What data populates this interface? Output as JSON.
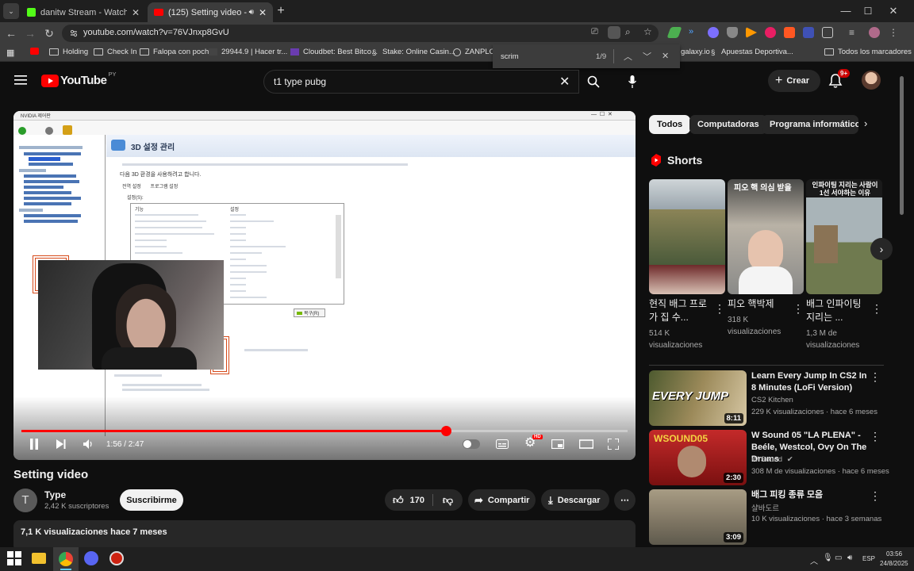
{
  "tabs": [
    {
      "title": "danitw Stream - Watch Live on",
      "active": false
    },
    {
      "title": "(125) Setting video - YouTube",
      "active": true
    }
  ],
  "address": {
    "url": "youtube.com/watch?v=76VJnxp8GvU"
  },
  "bookmarks": [
    "Holding",
    "Check In",
    "Falopa con pochi",
    "29944.9 | Hacer tr...",
    "Cloudbet: Best Bitco...",
    "Stake: Online Casin...",
    "ZANPLO",
    "galaxy.io",
    "Apuestas Deportiva...",
    "Todos los marcadores"
  ],
  "findbar": {
    "query": "scrim",
    "count": "1/9"
  },
  "youtube": {
    "logo_text": "YouTube",
    "country": "PY",
    "search_value": "t1 type pubg",
    "create_label": "Crear",
    "notif_count": "9+"
  },
  "player": {
    "time": "1:56 / 2:47",
    "progress": 0.7,
    "hd_badge": "HD"
  },
  "video": {
    "title": "Setting video",
    "channel": "Type",
    "subscribers": "2,42 K suscriptores",
    "subscribe_label": "Suscribirme",
    "likes": "170",
    "share_label": "Compartir",
    "download_label": "Descargar",
    "views_date": "7,1 K visualizaciones  hace 7 meses"
  },
  "screen_content": {
    "window_title": "NVIDIA 제어판",
    "panel_title": "3D 설정 관리",
    "panel_sub": "다음 3D 환경을 사용하려고 합니다.",
    "tabs": [
      "전역 설정",
      "프로그램 설정"
    ],
    "settings_header": "설정(S):",
    "col_feature": "기능",
    "col_setting": "설정",
    "restore_button": "복구(R)"
  },
  "chips": [
    "Todos",
    "Computadoras",
    "Programa informático"
  ],
  "shorts_title": "Shorts",
  "shorts": [
    {
      "title": "현직 배그 프로가 집 수...",
      "views": "514 K visualizaciones"
    },
    {
      "title": "피오 핵박제",
      "views": "318 K visualizaciones",
      "overlay": "피오 핵 의심 받을"
    },
    {
      "title": "배그 인파이팅 지리는 ...",
      "views": "1,3 M de visualizaciones",
      "overlay": "인파이팅 지리는 사람이\n1선 서야하는 이유"
    }
  ],
  "related": [
    {
      "title": "Learn Every Jump In CS2 In 8 Minutes (LoFi Version)",
      "channel": "CS2 Kitchen",
      "meta": "229 K visualizaciones · hace 6 meses",
      "duration": "8:11",
      "thumb_text": "EVERY JUMP"
    },
    {
      "title": "W Sound 05 \"LA PLENA\" - Beéle, Westcol, Ovy On The Drums",
      "channel": "W Sound",
      "meta": "308 M de visualizaciones · hace 6 meses",
      "duration": "2:30",
      "thumb_text": "WSOUND05"
    },
    {
      "title": "배그 피킹 종류 모음",
      "channel": "샬바도르",
      "meta": "10 K visualizaciones · hace 3 semanas",
      "duration": "3:09"
    }
  ],
  "taskbar": {
    "lang": "ESP",
    "time": "03:56",
    "date": "24/8/2025"
  },
  "colors": {
    "accent": "#ff0000",
    "bg": "#0f0f0f",
    "chrome": "#3c3c3c"
  }
}
